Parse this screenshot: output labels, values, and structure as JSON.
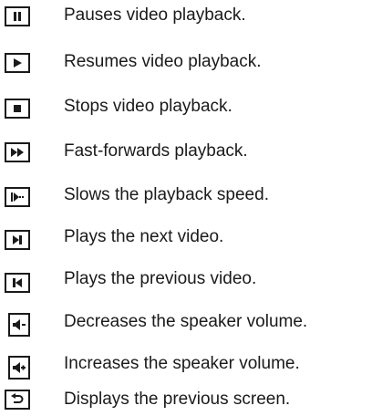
{
  "legend": {
    "items": [
      {
        "icon": "pause-icon",
        "description": "Pauses video playback."
      },
      {
        "icon": "play-icon",
        "description": "Resumes video playback."
      },
      {
        "icon": "stop-icon",
        "description": "Stops video playback."
      },
      {
        "icon": "fast-forward-icon",
        "description": "Fast-forwards playback."
      },
      {
        "icon": "slow-motion-icon",
        "description": "Slows the playback speed."
      },
      {
        "icon": "next-track-icon",
        "description": "Plays the next video."
      },
      {
        "icon": "previous-track-icon",
        "description": "Plays the previous video."
      },
      {
        "icon": "volume-down-icon",
        "description": "Decreases the speaker volume."
      },
      {
        "icon": "volume-up-icon",
        "description": "Increases the speaker volume."
      },
      {
        "icon": "back-icon",
        "description": "Displays the previous screen."
      }
    ]
  }
}
